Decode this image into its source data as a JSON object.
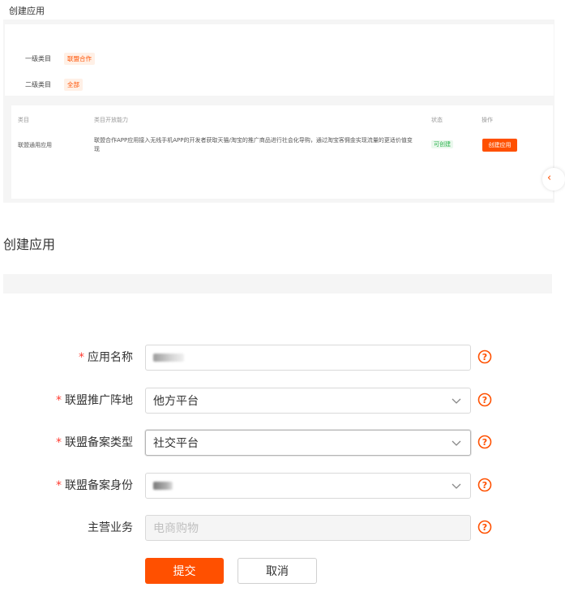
{
  "top": {
    "title": "创建应用",
    "categories": [
      {
        "label": "一级类目",
        "value": "联盟合作"
      },
      {
        "label": "二级类目",
        "value": "全部"
      }
    ],
    "table": {
      "headers": [
        "类目",
        "类目开放能力",
        "状态",
        "操作"
      ],
      "row": {
        "category": "联盟通用应用",
        "ability_line1": "联盟合作APP应用接入无线手机APP的开发者获取天猫/淘宝的推广商品进行社会化导购，通过淘宝客佣金实现流量的更适价值变",
        "ability_line2": "现",
        "status": "可创建",
        "action": "创建应用"
      }
    },
    "side_arrow": "‹"
  },
  "form": {
    "title": "创建应用",
    "fields": [
      {
        "label": "应用名称",
        "required": true,
        "value": "",
        "type": "input"
      },
      {
        "label": "联盟推广阵地",
        "required": true,
        "value": "他方平台",
        "type": "select"
      },
      {
        "label": "联盟备案类型",
        "required": true,
        "value": "社交平台",
        "type": "select"
      },
      {
        "label": "联盟备案身份",
        "required": true,
        "value": "",
        "type": "select"
      },
      {
        "label": "主营业务",
        "required": false,
        "placeholder": "电商购物",
        "type": "disabled"
      }
    ],
    "required_mark": "*",
    "submit_label": "提交",
    "cancel_label": "取消"
  },
  "colors": {
    "accent": "#ff5000",
    "required": "#ff3b30",
    "status_ok": "#2bb24c"
  },
  "icons": [
    "chevron-down-icon",
    "help-circle-icon",
    "chevron-left-icon"
  ]
}
